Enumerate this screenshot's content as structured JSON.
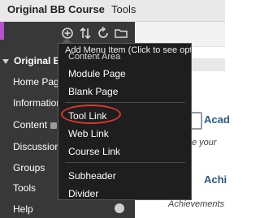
{
  "header": {
    "course_title": "Original BB Course",
    "tools_tab": "Tools"
  },
  "toolbar": {
    "icons": [
      "add-icon",
      "sort-icon",
      "refresh-icon",
      "folder-icon"
    ]
  },
  "sidebar": {
    "course_name": "Original BB",
    "items": [
      {
        "label": "Home Page"
      },
      {
        "label": "Information"
      },
      {
        "label": "Content"
      },
      {
        "label": "Discussions"
      },
      {
        "label": "Groups"
      },
      {
        "label": "Tools"
      },
      {
        "label": "Help"
      }
    ]
  },
  "menu": {
    "header": "Add Menu Item (Click to see options)",
    "partial_item": "Content Area",
    "items": [
      {
        "label": "Module Page"
      },
      {
        "label": "Blank Page"
      },
      {
        "label": "Tool Link"
      },
      {
        "label": "Web Link"
      },
      {
        "label": "Course Link"
      },
      {
        "label": "Subheader"
      },
      {
        "label": "Divider"
      }
    ]
  },
  "content": {
    "acad_heading": "Acad",
    "acad_sub": "e your",
    "achi_heading": "Achi",
    "achi_sub": "Achievements"
  },
  "colors": {
    "accent": "#b94fd1",
    "highlight": "#d9392b",
    "heading": "#2a5b88"
  }
}
